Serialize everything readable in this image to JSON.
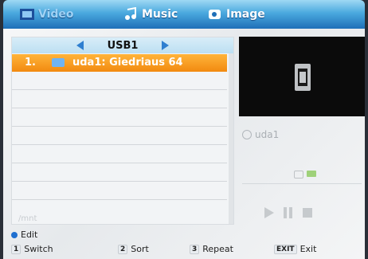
{
  "tabs": [
    {
      "label": "Video",
      "active": true,
      "icon": "video-folder-icon"
    },
    {
      "label": "Music",
      "active": false,
      "icon": "music-note-icon"
    },
    {
      "label": "Image",
      "active": false,
      "icon": "image-icon"
    }
  ],
  "list": {
    "source": "USB1",
    "rows": [
      {
        "num": "1.",
        "name": "uda1: Giedriaus 64",
        "selected": true
      }
    ],
    "path_text": "/mnt"
  },
  "preview": {
    "name": "uda1"
  },
  "help": {
    "edit": "Edit",
    "switch_key": "1",
    "switch": "Switch",
    "sort_key": "2",
    "sort": "Sort",
    "repeat_key": "3",
    "repeat": "Repeat",
    "exit_key": "EXIT",
    "exit": "Exit"
  },
  "colors": {
    "selection": "#f28a10",
    "tabbar": "#4aa9de",
    "arrow": "#2f7fd0"
  }
}
